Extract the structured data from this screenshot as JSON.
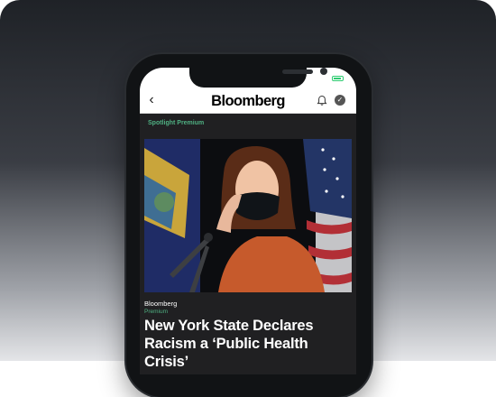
{
  "app": {
    "logo": "Bloomberg",
    "back_icon": "chevron-left-icon",
    "notification_icon": "bell-icon",
    "account_icon": "checkmark-circle-icon",
    "battery_icon": "battery-icon",
    "battery_color": "#2ecc71"
  },
  "article": {
    "section_label": "Spotlight Premium",
    "source": "Bloomberg",
    "tier": "Premium",
    "headline": "New York State Declares Racism a ‘Public Health Crisis’",
    "accent_color": "#4fb082"
  },
  "colors": {
    "screen_background": "#202022",
    "header_background": "#ffffff"
  }
}
